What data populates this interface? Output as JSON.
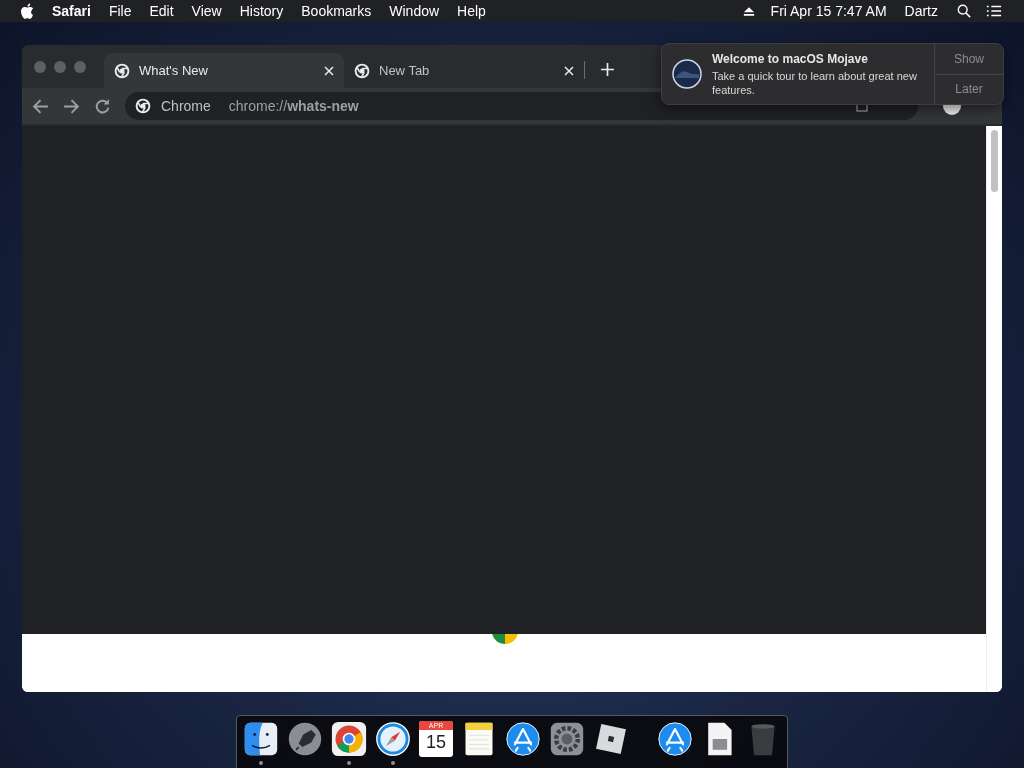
{
  "menu_bar": {
    "app_name": "Safari",
    "menus": [
      "File",
      "Edit",
      "View",
      "History",
      "Bookmarks",
      "Window",
      "Help"
    ],
    "clock": "Fri Apr 15  7:47 AM",
    "user": "Dartz"
  },
  "browser": {
    "tabs": [
      {
        "label": "What's New",
        "selected": true
      },
      {
        "label": "New Tab",
        "selected": false
      }
    ],
    "address_bar": {
      "site_label": "Chrome",
      "url": "chrome://**whats-new**"
    }
  },
  "notification": {
    "title": "Welcome to macOS Mojave",
    "body": "Take a quick tour to learn about great new features.",
    "buttons": [
      "Show",
      "Later"
    ]
  },
  "dock": {
    "apps": [
      {
        "kind": "finder",
        "running": true
      },
      {
        "kind": "launchpad",
        "running": false
      },
      {
        "kind": "chrome",
        "running": true
      },
      {
        "kind": "safari",
        "running": true
      },
      {
        "kind": "calendar",
        "running": false,
        "month": "APR",
        "day": "15"
      },
      {
        "kind": "notes",
        "running": false
      },
      {
        "kind": "appstore",
        "running": false
      },
      {
        "kind": "preferences",
        "running": false
      },
      {
        "kind": "roblox",
        "running": false
      }
    ],
    "others": [
      {
        "kind": "appstore"
      },
      {
        "kind": "document"
      },
      {
        "kind": "trash"
      }
    ]
  }
}
